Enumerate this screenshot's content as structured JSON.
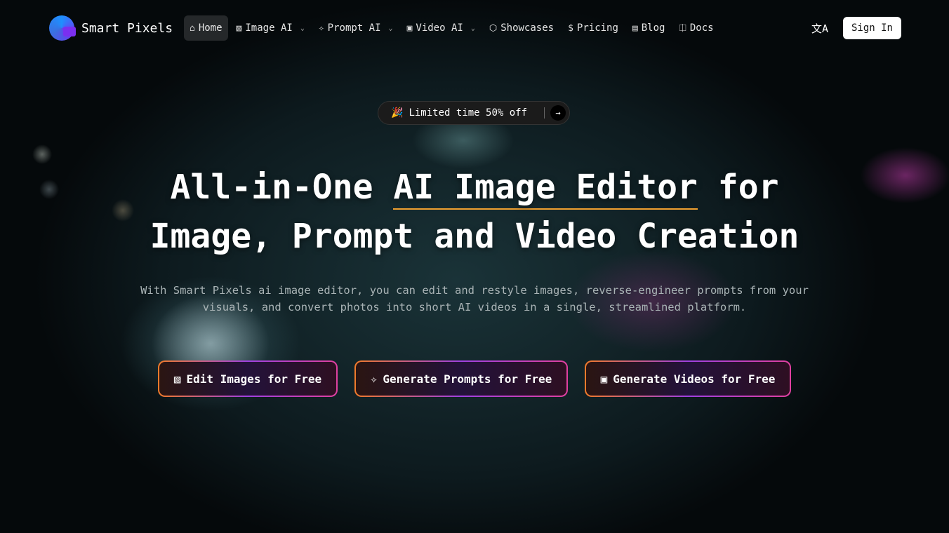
{
  "brand": {
    "name": "Smart Pixels"
  },
  "nav": {
    "items": [
      {
        "label": "Home",
        "icon": "home-icon"
      },
      {
        "label": "Image AI",
        "icon": "image-edit-icon",
        "dropdown": true
      },
      {
        "label": "Prompt AI",
        "icon": "sparkle-icon",
        "dropdown": true
      },
      {
        "label": "Video AI",
        "icon": "play-icon",
        "dropdown": true
      },
      {
        "label": "Showcases",
        "icon": "cube-icon"
      },
      {
        "label": "Pricing",
        "icon": "dollar-icon"
      },
      {
        "label": "Blog",
        "icon": "newspaper-icon"
      },
      {
        "label": "Docs",
        "icon": "book-icon"
      }
    ],
    "sign_in": "Sign In"
  },
  "promo": {
    "label": "Limited time 50% off"
  },
  "hero": {
    "title_pre": "All-in-One ",
    "title_highlight": "AI Image Editor",
    "title_post": " for",
    "title_line2": "Image, Prompt and Video Creation",
    "subtitle": "With Smart Pixels ai image editor, you can edit and restyle images, reverse-engineer prompts from your visuals, and convert photos into short AI videos in a single, streamlined platform."
  },
  "ctas": [
    {
      "label": "Edit Images for Free"
    },
    {
      "label": "Generate Prompts for Free"
    },
    {
      "label": "Generate Videos for Free"
    }
  ],
  "colors": {
    "accent_orange": "#f07a2a",
    "accent_purple": "#a040e0",
    "accent_pink": "#e040a0"
  }
}
